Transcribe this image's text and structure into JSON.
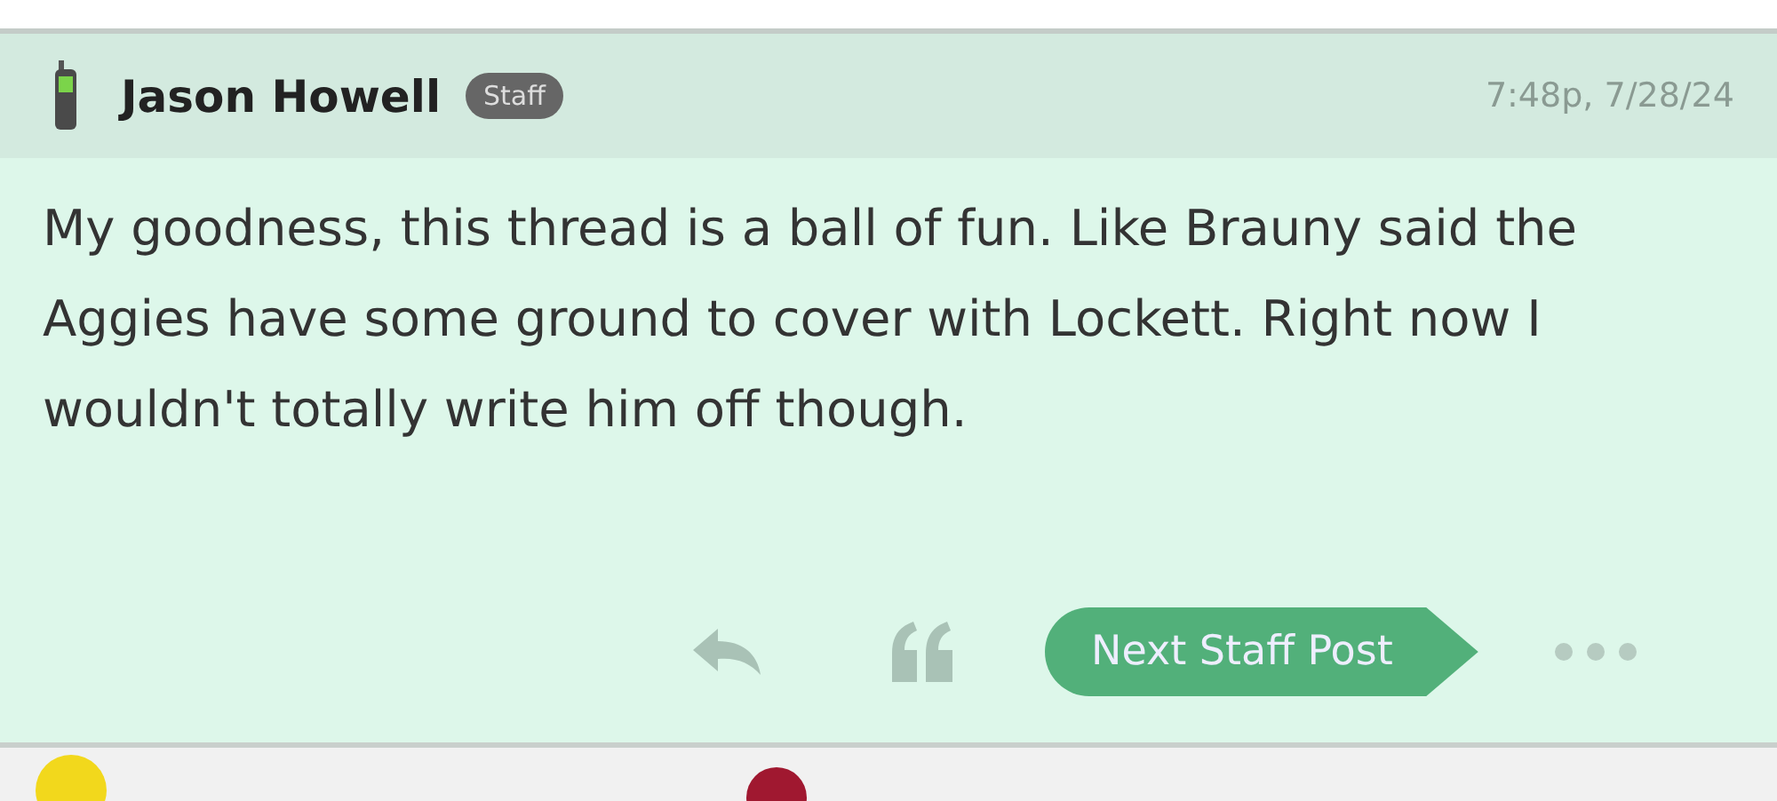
{
  "post": {
    "author": "Jason Howell",
    "badge": "Staff",
    "time": "7:48p, 7/28/24",
    "body": "My goodness, this thread is a ball of fun. Like Brauny said the Aggies have some ground to cover with Lockett. Right now I wouldn't totally write him off though.",
    "next_button": "Next Staff Post"
  }
}
